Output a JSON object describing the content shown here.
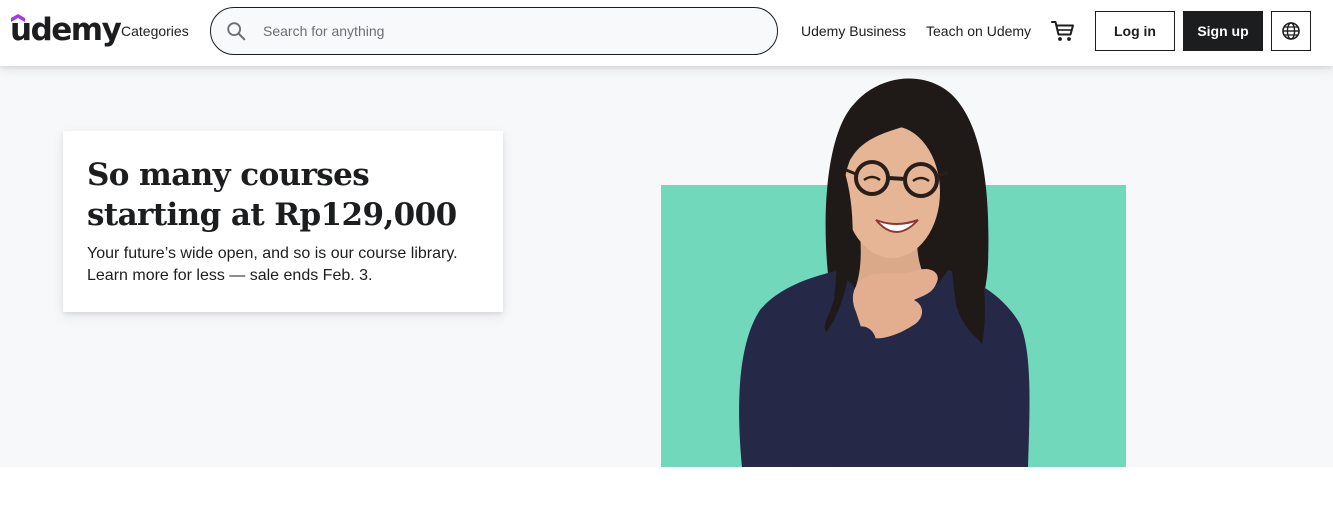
{
  "header": {
    "logo_text": "udemy",
    "categories_label": "Categories",
    "search": {
      "placeholder": "Search for anything",
      "value": ""
    },
    "business_label": "Udemy Business",
    "teach_label": "Teach on Udemy",
    "login_label": "Log in",
    "signup_label": "Sign up",
    "icons": {
      "search": "search-icon",
      "cart": "cart-icon",
      "language": "globe-icon"
    },
    "brand_color": "#a435f0"
  },
  "hero": {
    "title": "So many courses starting at Rp129,000",
    "body": "Your future’s wide open, and so is our course library. Learn more for less — sale ends Feb. 3.",
    "accent_color": "#72d8bb"
  }
}
